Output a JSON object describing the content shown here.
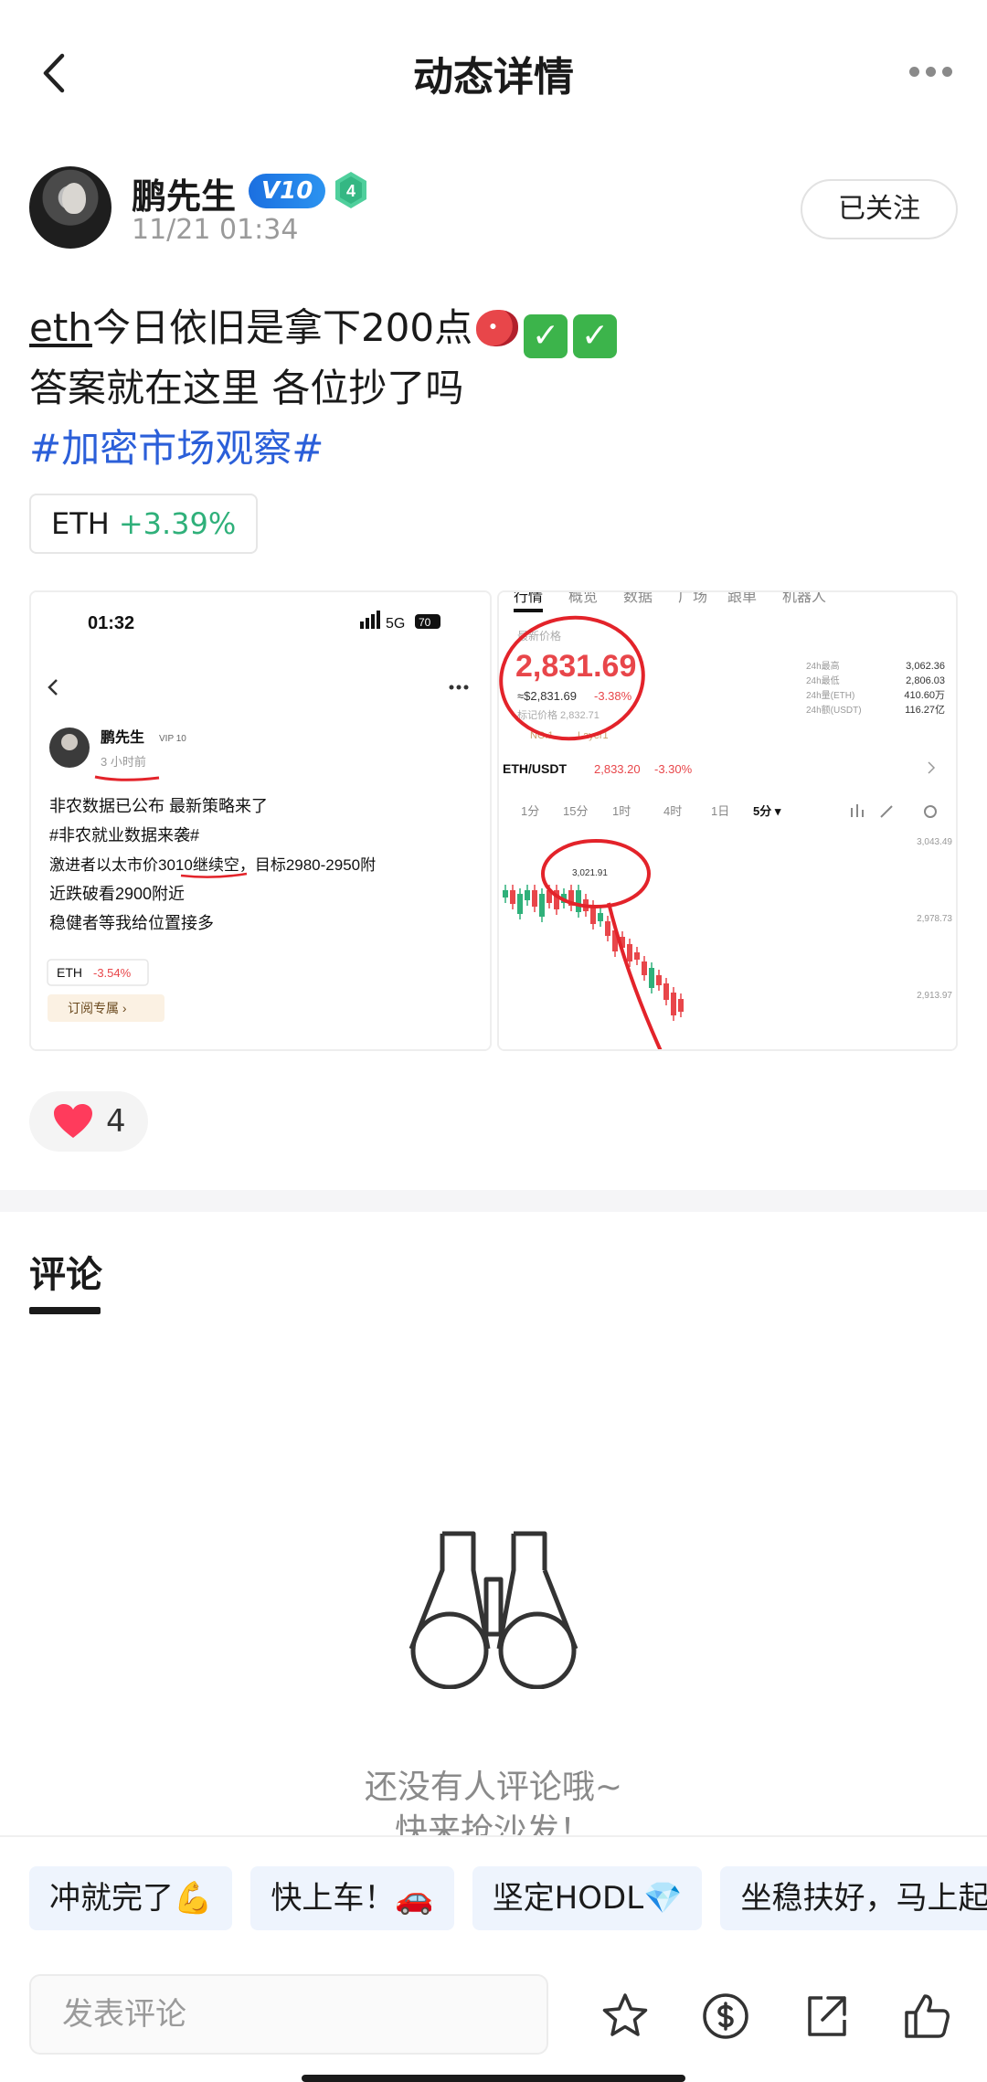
{
  "header": {
    "title": "动态详情"
  },
  "author": {
    "name": "鹏先生",
    "vip_label": "V10",
    "level": "4",
    "time": "11/21 01:34",
    "follow_label": "已关注"
  },
  "post": {
    "line1_prefix": "eth",
    "line1_text": "今日依旧是拿下200点",
    "line2": "答案就在这里 各位抄了吗",
    "hashtag": "#加密市场观察#"
  },
  "coin_tag": {
    "symbol": "ETH",
    "change": "+3.39%",
    "change_color": "#2fb07a"
  },
  "images": {
    "left": {
      "status_time": "01:32",
      "network": "5G",
      "battery": "70",
      "author": "鹏先生",
      "vip": "VIP 10",
      "time_ago": "3 小时前",
      "lines": [
        "非农数据已公布 最新策略来了",
        "#非农就业数据来袭#",
        "激进者以太市价3010继续空，目标2980-2950附",
        "近跌破看2900附近",
        "稳健者等我给位置接多"
      ],
      "coin": "ETH",
      "coin_change": "-3.54%",
      "subscribe": "订阅专属 ›"
    },
    "right": {
      "tabs": [
        "行情",
        "概览",
        "数据",
        "广场",
        "跟单",
        "机器人"
      ],
      "latest_label": "最新价格",
      "price": "2,831.69",
      "price_sub": "≈$2,831.69",
      "price_change": "-3.38%",
      "mark_price": "标记价格 2,832.71",
      "rank": "NO.1",
      "layer": "Layer1",
      "stats_labels": [
        "24h最高",
        "24h最低",
        "24h量(ETH)",
        "24h额(USDT)"
      ],
      "stats_values": [
        "3,062.36",
        "2,806.03",
        "410.60万",
        "116.27亿"
      ],
      "pair": "ETH/USDT",
      "pair_price": "2,833.20",
      "pair_change": "-3.30%",
      "intervals": [
        "1分",
        "15分",
        "1时",
        "4时",
        "1日",
        "5分 ▾"
      ],
      "axis": [
        "3,043.49",
        "2,978.73",
        "2,913.97"
      ],
      "peak_label": "3,021.91"
    }
  },
  "likes": {
    "count": "4"
  },
  "comments": {
    "tab_label": "评论",
    "empty_line1": "还没有人评论哦~",
    "empty_line2": "快来抢沙发！"
  },
  "quick_replies": [
    "冲就完了💪",
    "快上车！🚗",
    "坚定HODL💎",
    "坐稳扶好，马上起飞"
  ],
  "bottom": {
    "input_placeholder": "发表评论"
  },
  "colors": {
    "accent": "#2b5fd9",
    "up": "#2fb07a",
    "down": "#e8464a",
    "like": "#ff3b5c"
  }
}
